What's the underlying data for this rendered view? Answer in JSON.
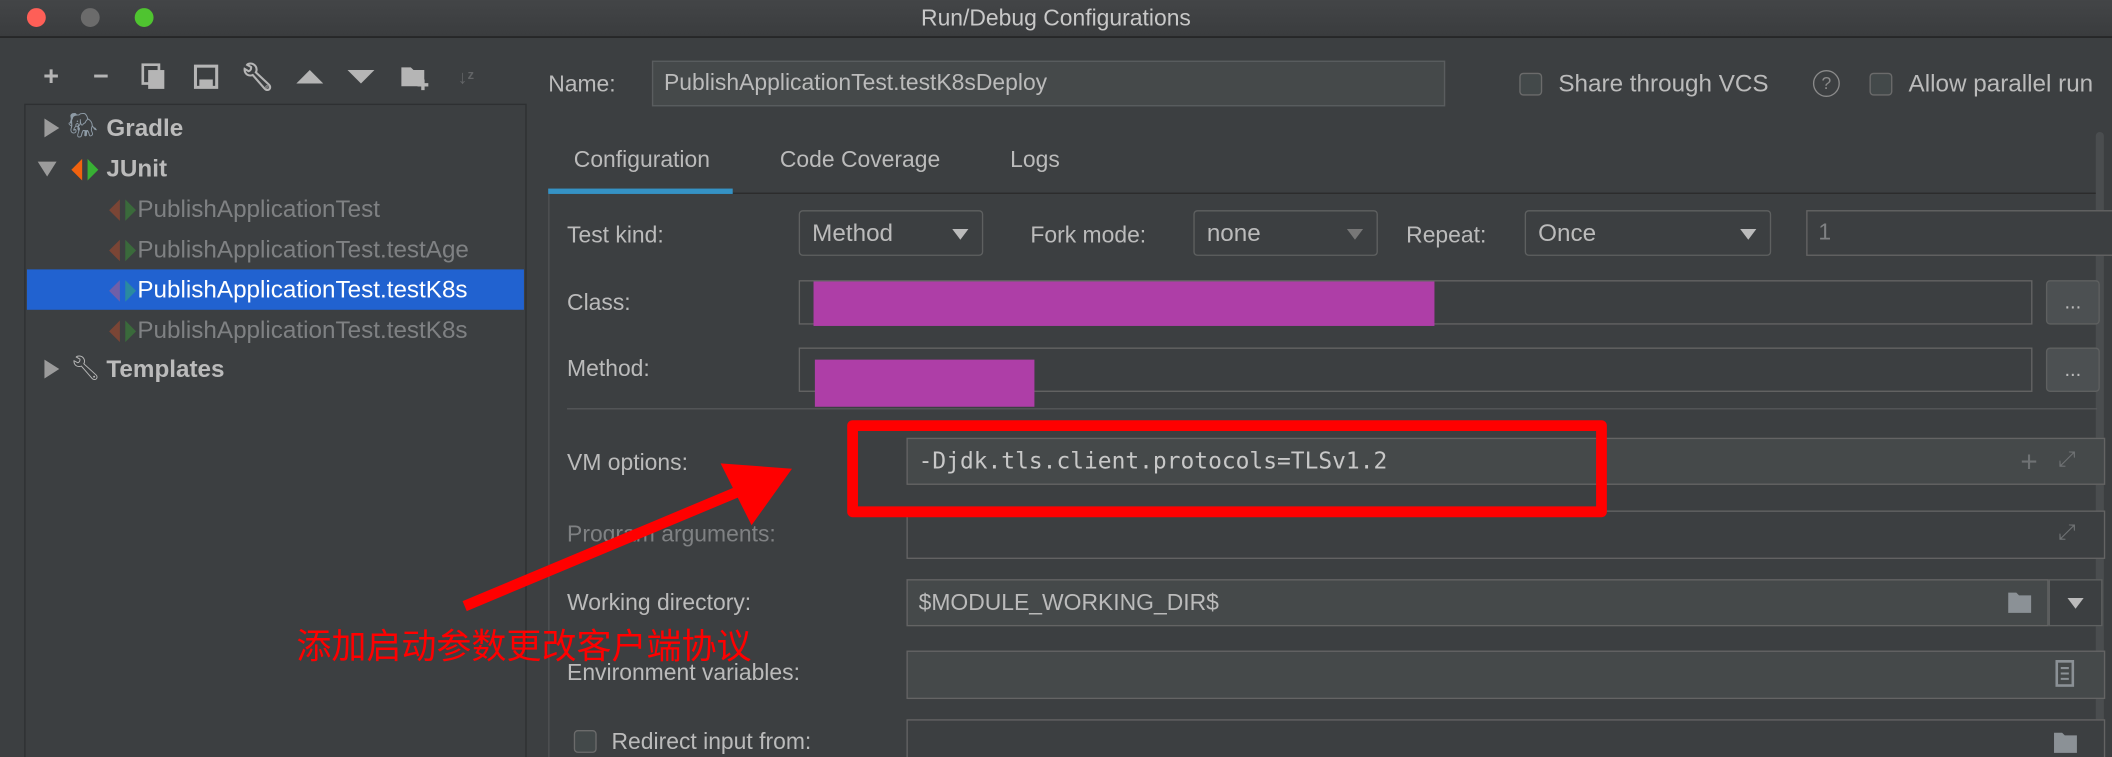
{
  "window": {
    "title": "Run/Debug Configurations"
  },
  "toolbar": {
    "icons": [
      "plus-icon",
      "minus-icon",
      "copy-icon",
      "save-icon",
      "wrench-icon",
      "arrow-up-icon",
      "arrow-down-icon",
      "new-folder-icon",
      "sort-alpha-icon"
    ]
  },
  "tree": {
    "gradle": "Gradle",
    "junit": "JUnit",
    "children": [
      "PublishApplicationTest",
      "PublishApplicationTest.testAge",
      "PublishApplicationTest.testK8s",
      "PublishApplicationTest.testK8s"
    ],
    "selected_index": 2,
    "templates": "Templates"
  },
  "name": {
    "label": "Name:",
    "value": "PublishApplicationTest.testK8sDeploy"
  },
  "share_vcs": {
    "label": "Share through VCS",
    "checked": false
  },
  "allow_parallel": {
    "label": "Allow parallel run",
    "checked": false
  },
  "tabs": [
    {
      "label": "Configuration",
      "active": true
    },
    {
      "label": "Code Coverage"
    },
    {
      "label": "Logs"
    }
  ],
  "form": {
    "test_kind": {
      "label": "Test kind:",
      "value": "Method"
    },
    "fork_mode": {
      "label": "Fork mode:",
      "value": "none"
    },
    "repeat": {
      "label": "Repeat:",
      "value": "Once",
      "count": "1"
    },
    "class": {
      "label": "Class:",
      "button": "..."
    },
    "method": {
      "label": "Method:",
      "button": "..."
    },
    "vm_options": {
      "label": "VM options:",
      "value": "-Djdk.tls.client.protocols=TLSv1.2"
    },
    "program_arguments": {
      "label": "Program arguments:",
      "value": ""
    },
    "working_directory": {
      "label": "Working directory:",
      "value": "$MODULE_WORKING_DIR$"
    },
    "environment_variables": {
      "label": "Environment variables:",
      "value": ""
    },
    "redirect_input": {
      "label": "Redirect input from:",
      "checked": false
    }
  },
  "annotation": {
    "text": "添加启动参数更改客户端协议",
    "color": "#ff0000"
  },
  "colors": {
    "selection": "#2162d0",
    "redaction": "#ae3ea7",
    "accent": "#3592c4"
  }
}
